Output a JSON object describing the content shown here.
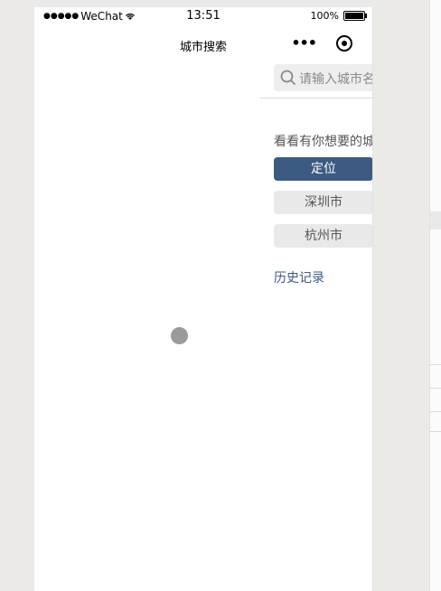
{
  "status_bar": {
    "signal": "●●●●●",
    "carrier": "WeChat",
    "time": "13:51",
    "battery_text": "100%"
  },
  "nav": {
    "title": "城市搜索",
    "more": "•••"
  },
  "search": {
    "placeholder": "请输入城市名"
  },
  "hint": "看看有你想要的城市吗",
  "buttons": {
    "locate": "定位"
  },
  "cities": [
    "深圳市",
    "杭州市"
  ],
  "history_label": "历史记录"
}
